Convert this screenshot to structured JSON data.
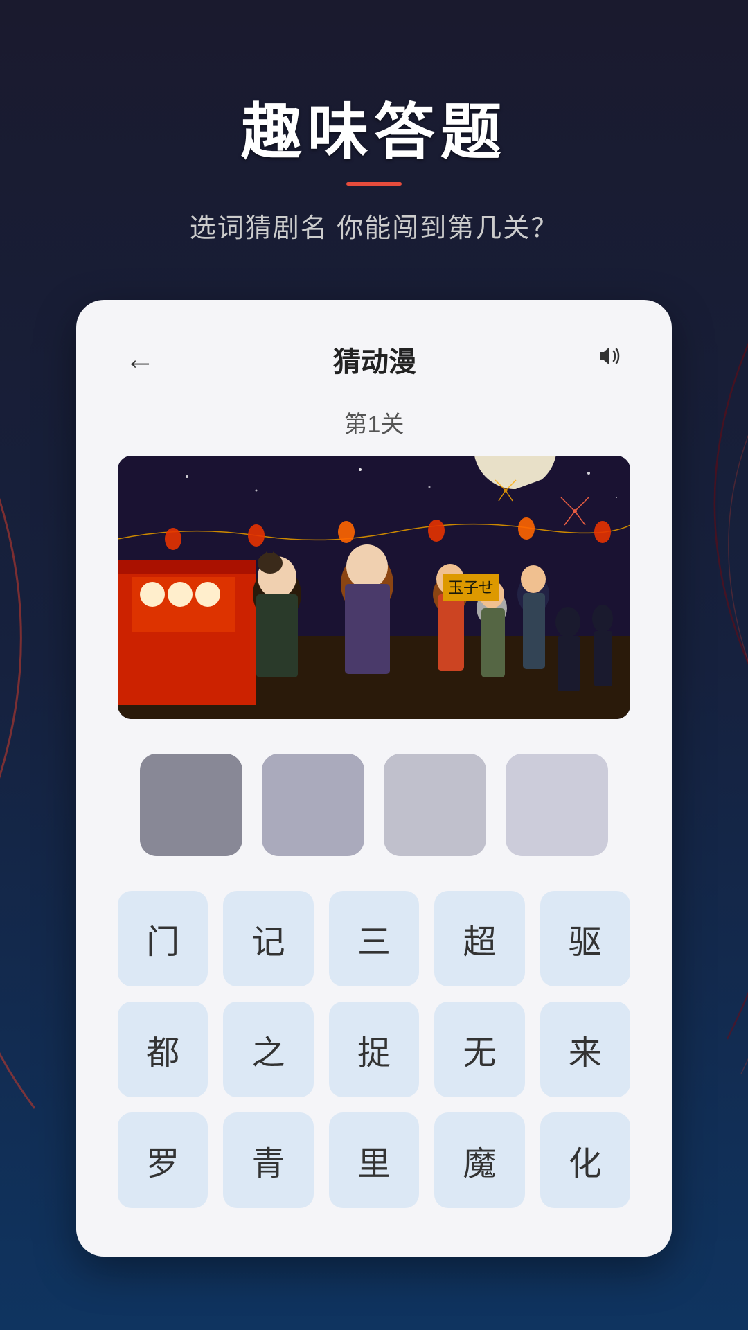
{
  "background": {
    "color": "#1a1a2e"
  },
  "header": {
    "main_title": "趣味答题",
    "subtitle": "选词猜剧名 你能闯到第几关？"
  },
  "card": {
    "back_label": "←",
    "title": "猜动漫",
    "sound_icon": "🔊",
    "level": "第1关",
    "answer_boxes_count": 4
  },
  "answer_boxes": [
    {
      "id": 1,
      "filled": false
    },
    {
      "id": 2,
      "filled": false
    },
    {
      "id": 3,
      "filled": false
    },
    {
      "id": 4,
      "filled": false
    }
  ],
  "char_grid": [
    [
      "门",
      "记",
      "三",
      "超",
      "驱"
    ],
    [
      "都",
      "之",
      "捉",
      "无",
      "来"
    ],
    [
      "罗",
      "青",
      "里",
      "魔",
      "化"
    ]
  ]
}
